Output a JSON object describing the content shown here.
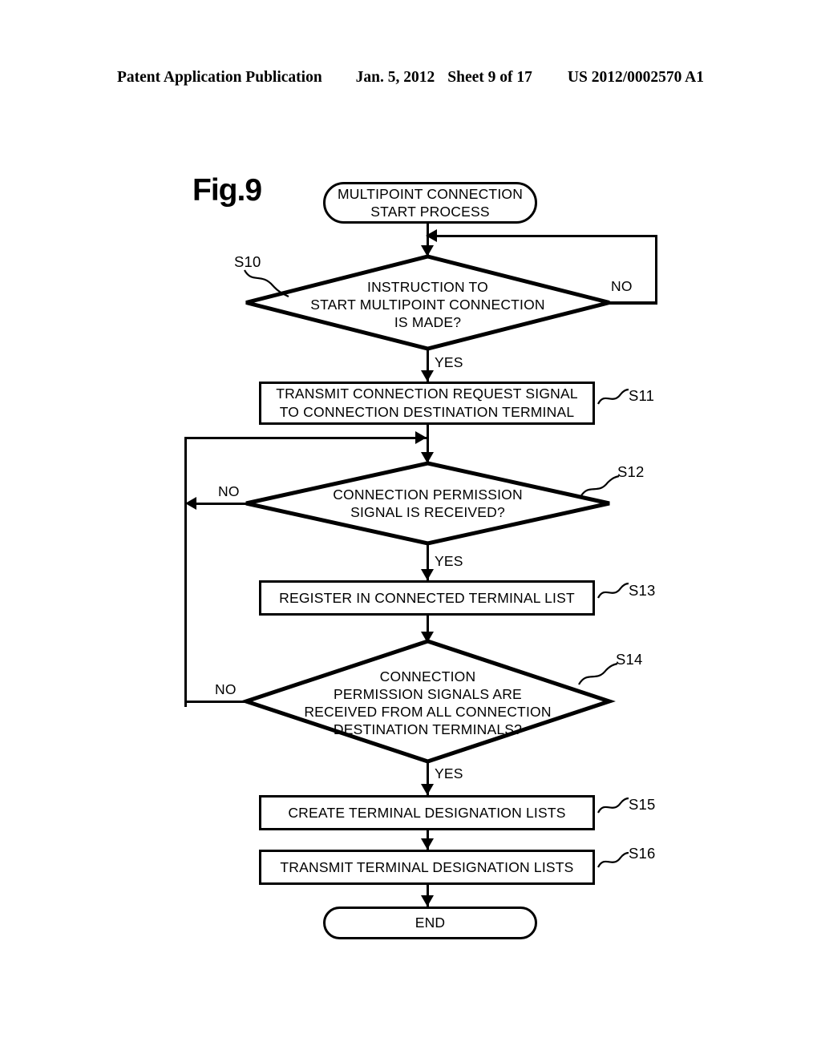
{
  "header": {
    "publication": "Patent Application Publication",
    "date": "Jan. 5, 2012",
    "sheet": "Sheet 9 of 17",
    "patent_number": "US 2012/0002570 A1"
  },
  "figure": {
    "label": "Fig.9"
  },
  "flowchart": {
    "start": {
      "id": "start",
      "text_line1": "MULTIPOINT CONNECTION",
      "text_line2": "START PROCESS"
    },
    "s10": {
      "step": "S10",
      "line1": "INSTRUCTION TO",
      "line2": "START MULTIPOINT CONNECTION",
      "line3": "IS MADE?",
      "yes": "YES",
      "no": "NO"
    },
    "s11": {
      "step": "S11",
      "line1": "TRANSMIT CONNECTION REQUEST SIGNAL",
      "line2": "TO CONNECTION DESTINATION TERMINAL"
    },
    "s12": {
      "step": "S12",
      "line1": "CONNECTION PERMISSION",
      "line2": "SIGNAL IS RECEIVED?",
      "yes": "YES",
      "no": "NO"
    },
    "s13": {
      "step": "S13",
      "line1": "REGISTER IN CONNECTED TERMINAL LIST"
    },
    "s14": {
      "step": "S14",
      "line1": "CONNECTION",
      "line2": "PERMISSION SIGNALS ARE",
      "line3": "RECEIVED FROM ALL CONNECTION",
      "line4": "DESTINATION TERMINALS?",
      "yes": "YES",
      "no": "NO"
    },
    "s15": {
      "step": "S15",
      "line1": "CREATE TERMINAL DESIGNATION LISTS"
    },
    "s16": {
      "step": "S16",
      "line1": "TRANSMIT TERMINAL DESIGNATION LISTS"
    },
    "end": {
      "id": "end",
      "text": "END"
    }
  },
  "colors": {
    "ink": "#000000",
    "paper": "#ffffff"
  }
}
